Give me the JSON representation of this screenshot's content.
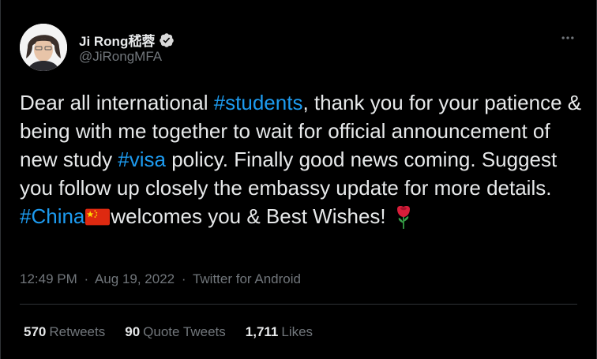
{
  "author": {
    "display_name": "Ji Rong嵇蓉",
    "handle": "@JiRongMFA"
  },
  "icons": {
    "verified": "verified-badge-icon",
    "more": "more-options-icon",
    "flag": "china-flag-emoji",
    "rose": "rose-emoji"
  },
  "tweet": {
    "t1": "Dear all international ",
    "h1": "#students",
    "t2": ", thank you for your patience & being with me together to wait for official announcement of new study ",
    "h2": "#visa",
    "t3": " policy. Finally good news coming. Suggest you follow up closely the embassy update for more details. ",
    "h3": "#China",
    "t4": "welcomes you & Best Wishes! "
  },
  "meta": {
    "time": "12:49 PM",
    "sep1": "·",
    "date": "Aug 19, 2022",
    "sep2": "·",
    "source": "Twitter for Android"
  },
  "stats": {
    "retweets_count": "570",
    "retweets_label": "Retweets",
    "quotes_count": "90",
    "quotes_label": "Quote Tweets",
    "likes_count": "1,711",
    "likes_label": "Likes"
  },
  "colors": {
    "background": "#000000",
    "text": "#e7e9ea",
    "secondary": "#71767b",
    "link": "#1d9bf0",
    "verified": "#d9d9d9",
    "divider": "#2f3336"
  }
}
